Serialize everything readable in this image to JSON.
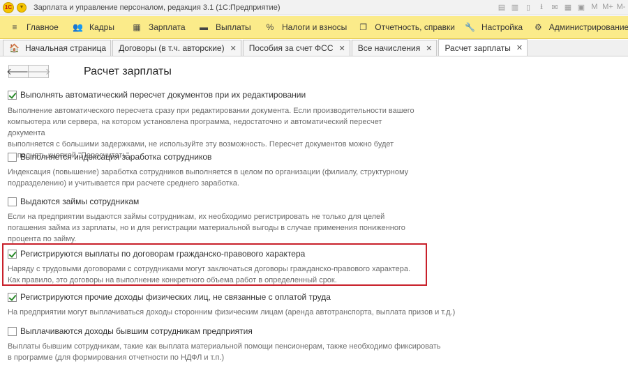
{
  "titlebar": {
    "logo": "1С",
    "title": "Зарплата и управление персоналом, редакция 3.1  (1С:Предприятие)",
    "tools": [
      "save-icon",
      "print-icon",
      "doc-icon",
      "download-icon",
      "mail-icon",
      "table-icon",
      "calendar-icon",
      "M",
      "M+",
      "M-"
    ]
  },
  "sections": [
    {
      "icon": "menu-icon",
      "glyph": "≡",
      "label": "Главное"
    },
    {
      "icon": "people-icon",
      "glyph": "👥",
      "label": "Кадры"
    },
    {
      "icon": "calc-icon",
      "glyph": "▦",
      "label": "Зарплата"
    },
    {
      "icon": "wallet-icon",
      "glyph": "▬",
      "label": "Выплаты"
    },
    {
      "icon": "percent-icon",
      "glyph": "%",
      "label": "Налоги и взносы"
    },
    {
      "icon": "reports-icon",
      "glyph": "❐",
      "label": "Отчетность, справки"
    },
    {
      "icon": "wrench-icon",
      "glyph": "🔧",
      "label": "Настройка"
    },
    {
      "icon": "gear-icon",
      "glyph": "⚙",
      "label": "Администрирование"
    }
  ],
  "tabs": [
    {
      "label": "Начальная страница",
      "home": true,
      "close": false,
      "active": false
    },
    {
      "label": "Договоры (в т.ч. авторские)",
      "home": false,
      "close": true,
      "active": false
    },
    {
      "label": "Пособия за счет ФСС",
      "home": false,
      "close": true,
      "active": false
    },
    {
      "label": "Все начисления",
      "home": false,
      "close": true,
      "active": false
    },
    {
      "label": "Расчет зарплаты",
      "home": false,
      "close": true,
      "active": true
    }
  ],
  "nav": {
    "back": "🡐",
    "forward": "🡒"
  },
  "page": {
    "title": "Расчет зарплаты"
  },
  "options": [
    {
      "label": "Выполнять автоматический пересчет документов при их редактировании",
      "checked": true,
      "description": [
        "Выполнение автоматического пересчета сразу при редактировании документа. Если производительности вашего",
        "компьютера или сервера, на котором установлена программа, недостаточно и автоматический пересчет документа",
        "выполняется с большими задержками, не используйте эту возможность. Пересчет документов можно будет",
        "выполнять кнопкой \"Пересчитать\"."
      ]
    },
    {
      "label": "Выполняется индексация заработка сотрудников",
      "checked": false,
      "description": [
        "Индексация (повышение) заработка сотрудников выполняется в целом по организации (филиалу, структурному",
        "подразделению) и учитывается при расчете среднего заработка."
      ]
    },
    {
      "label": "Выдаются займы сотрудникам",
      "checked": false,
      "description": [
        "Если на предприятии выдаются займы сотрудникам, их необходимо регистрировать не только для целей",
        "погашения займа из зарплаты, но и для регистрации материальной выгоды в случае применения пониженного",
        "процента по займу."
      ]
    },
    {
      "label": "Регистрируются выплаты по договорам гражданско-правового характера",
      "checked": true,
      "description": [
        "Наряду с трудовыми договорами с сотрудниками могут заключаться договоры гражданско-правового характера.",
        "Как правило, это договоры на выполнение конкретного объема работ в определенный срок."
      ]
    },
    {
      "label": "Регистрируются прочие доходы физических лиц, не связанные с оплатой труда",
      "checked": true,
      "description": [
        "На предприятии могут выплачиваться доходы сторонним физическим лицам (аренда автотранспорта, выплата призов и т.д.)"
      ]
    },
    {
      "label": "Выплачиваются доходы бывшим сотрудникам предприятия",
      "checked": false,
      "description": [
        "Выплаты бывшим сотрудникам, такие как выплата материальной помощи пенсионерам, также необходимо фиксировать",
        "в программе (для формирования отчетности по НДФЛ и т.п.)"
      ]
    }
  ],
  "highlight_color": "#c8202a"
}
